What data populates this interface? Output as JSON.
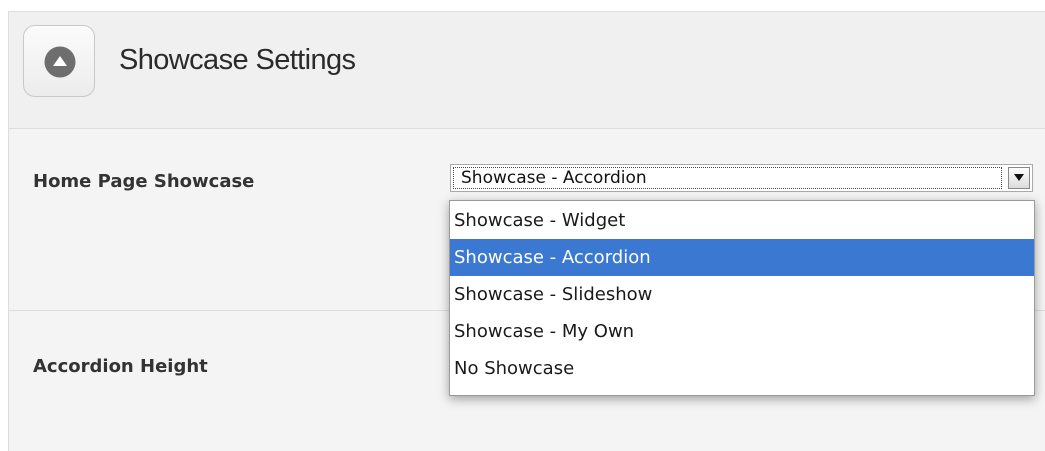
{
  "panel": {
    "title": "Showcase Settings",
    "toggle_icon": "collapse-up-icon"
  },
  "fields": {
    "home_showcase": {
      "label": "Home Page Showcase",
      "selected": "Showcase - Accordion",
      "options": [
        {
          "label": "Showcase - Widget",
          "selected": false
        },
        {
          "label": "Showcase - Accordion",
          "selected": true
        },
        {
          "label": "Showcase - Slideshow",
          "selected": false
        },
        {
          "label": "Showcase - My Own",
          "selected": false
        },
        {
          "label": "No Showcase",
          "selected": false
        }
      ]
    },
    "accordion_height": {
      "label": "Accordion Height"
    }
  },
  "colors": {
    "highlight": "#3a78d2",
    "panel_bg": "#f4f4f4"
  }
}
